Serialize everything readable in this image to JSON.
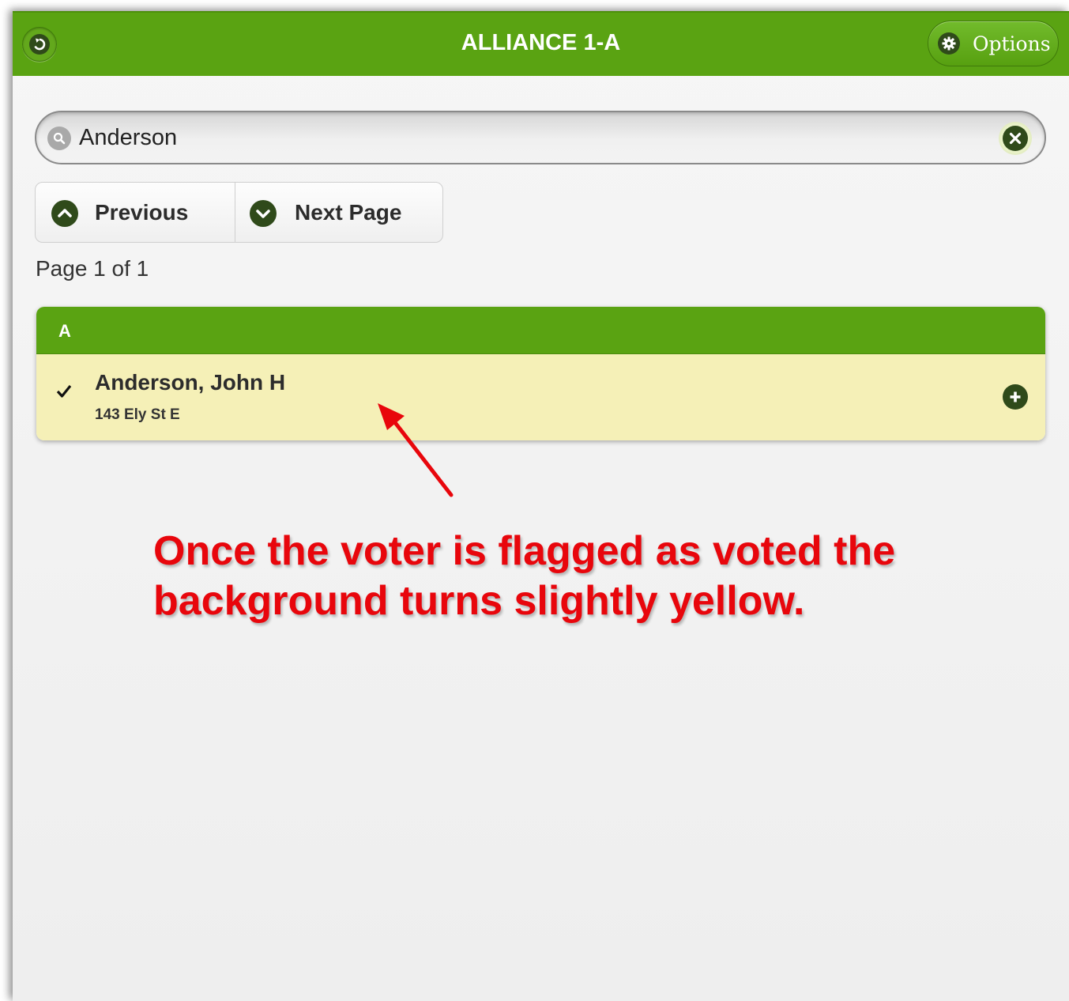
{
  "header": {
    "title": "ALLIANCE 1-A",
    "back_icon": "back-arrow-icon",
    "options_label": "Options",
    "options_icon": "gear-icon"
  },
  "search": {
    "value": "Anderson",
    "placeholder": "",
    "search_icon": "search-icon",
    "clear_icon": "clear-icon"
  },
  "pager": {
    "previous_label": "Previous",
    "next_label": "Next Page",
    "page_info": "Page 1 of 1"
  },
  "list": {
    "divider_label": "A",
    "items": [
      {
        "name": "Anderson, John H",
        "address": "143 Ely St E",
        "voted": true,
        "background": "#f5f0b7"
      }
    ]
  },
  "annotation": {
    "text": "Once the voter is flagged as voted the background turns slightly yellow.",
    "color": "#e8060c"
  },
  "colors": {
    "brand_green": "#5aa312",
    "icon_dark": "#2f4a1a",
    "voted_yellow": "#f5f0b7"
  }
}
